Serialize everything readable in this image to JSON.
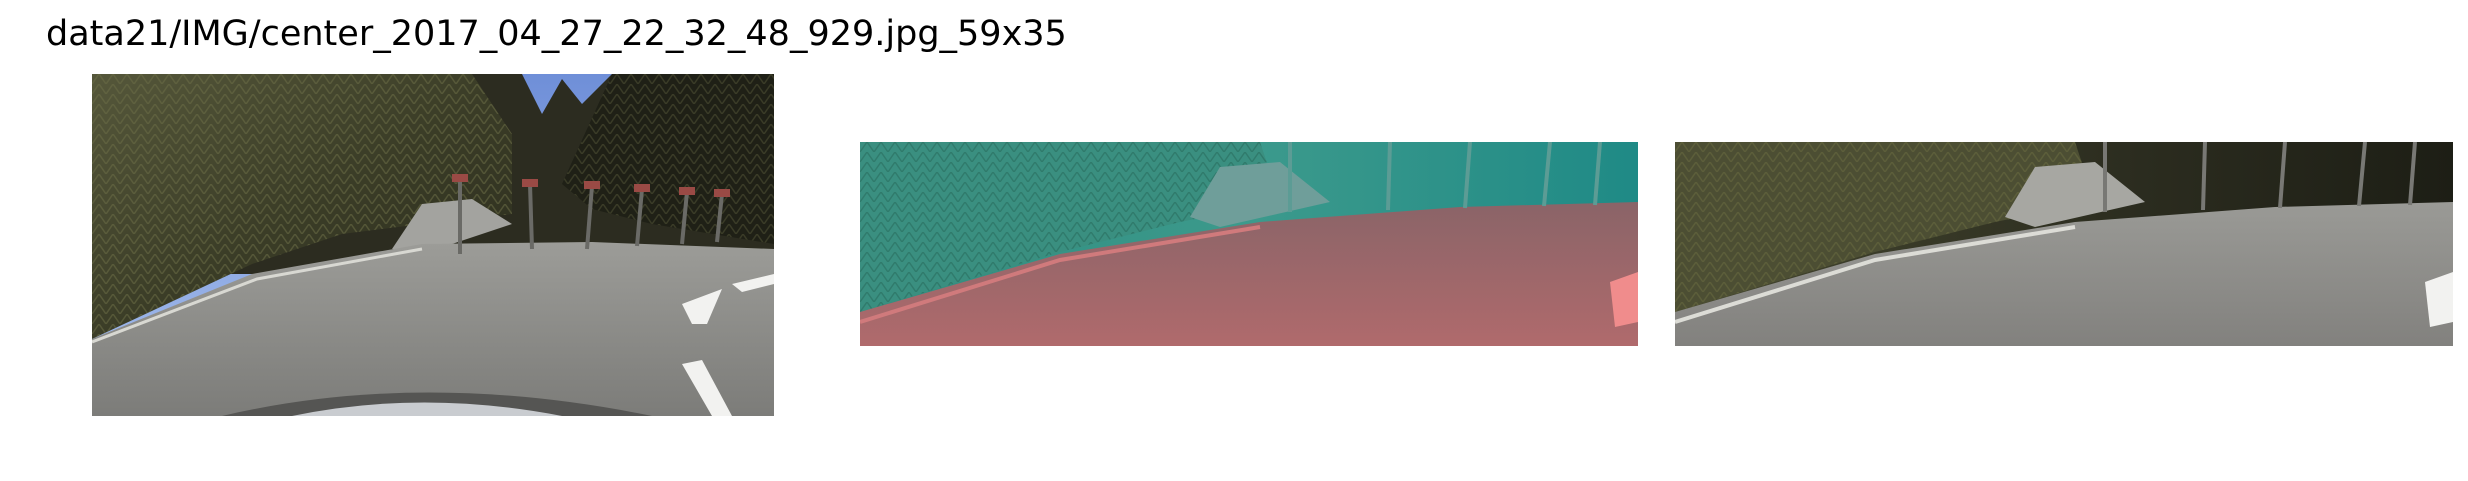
{
  "figure": {
    "title": "data21/IMG/center_2017_04_27_22_32_48_929.jpg_59x35"
  },
  "panels": [
    {
      "kind": "original-frame"
    },
    {
      "kind": "color-transformed-crop"
    },
    {
      "kind": "cropped-frame"
    }
  ]
}
